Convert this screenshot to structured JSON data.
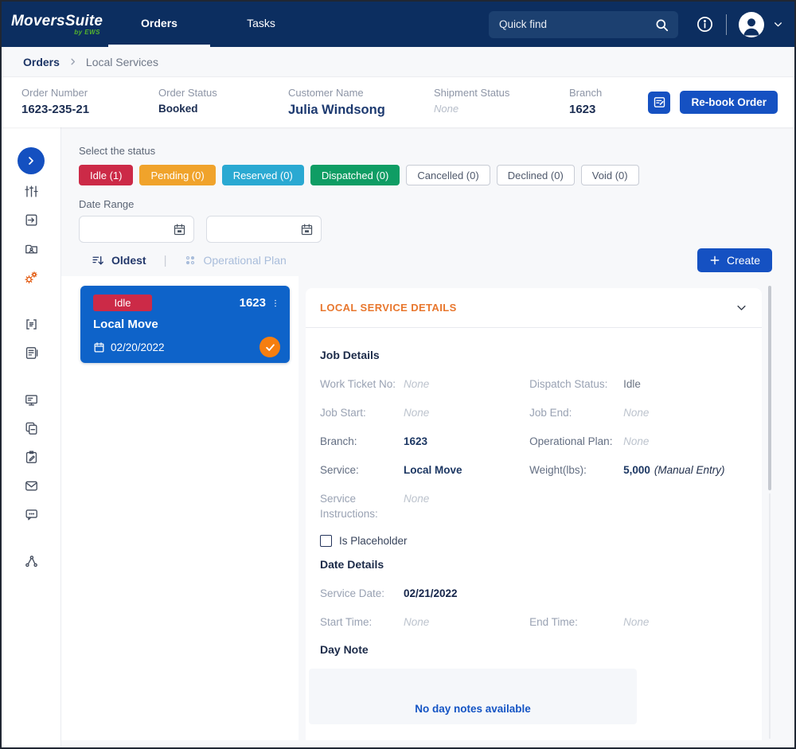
{
  "colors": {
    "navbar_bg": "#0C2E60",
    "accent_blue": "#1551C2",
    "card_blue": "#0E63C9",
    "details_header_orange": "#E8772E",
    "logo_byline_green": "#54B42D",
    "check_circle_orange": "#F57E10",
    "status_idle": "#CC2A47",
    "status_pending": "#F0A32B",
    "status_reserved": "#2AA9D2",
    "status_dispatched": "#0F9D64"
  },
  "navbar": {
    "logo_title": "MoversSuite",
    "logo_byline": "by EWS",
    "tab_orders": "Orders",
    "tab_tasks": "Tasks",
    "search_placeholder": "Quick find"
  },
  "breadcrumb": {
    "root": "Orders",
    "current": "Local Services"
  },
  "order_bar": {
    "order_number_label": "Order Number",
    "order_number": "1623-235-21",
    "order_status_label": "Order Status",
    "order_status": "Booked",
    "customer_name_label": "Customer Name",
    "customer_name": "Julia Windsong",
    "shipment_status_label": "Shipment Status",
    "shipment_status": "None",
    "branch_label": "Branch",
    "branch": "1623",
    "rebook_label": "Re-book Order"
  },
  "filters": {
    "select_label": "Select the status",
    "statuses": [
      {
        "label": "Idle (1)",
        "color": "#CC2A47"
      },
      {
        "label": "Pending (0)",
        "color": "#F0A32B"
      },
      {
        "label": "Reserved (0)",
        "color": "#2AA9D2"
      },
      {
        "label": "Dispatched (0)",
        "color": "#0F9D64"
      },
      {
        "label": "Cancelled (0)",
        "color": "#FFFFFF"
      },
      {
        "label": "Declined (0)",
        "color": "#FFFFFF"
      },
      {
        "label": "Void (0)",
        "color": "#FFFFFF"
      }
    ],
    "date_range_label": "Date Range",
    "start_date_value": "",
    "end_date_value": "",
    "sort_label": "Oldest",
    "plan_label": "Operational Plan",
    "create_label": "Create"
  },
  "card": {
    "status": "Idle",
    "number": "1623",
    "title": "Local Move",
    "date": "02/20/2022"
  },
  "details": {
    "header": "LOCAL SERVICE DETAILS",
    "job_section_title": "Job Details",
    "work_ticket_label": "Work Ticket No:",
    "work_ticket_value": "None",
    "dispatch_status_label": "Dispatch Status:",
    "dispatch_status_value": "Idle",
    "job_start_label": "Job Start:",
    "job_start_value": "None",
    "job_end_label": "Job End:",
    "job_end_value": "None",
    "branch_label": "Branch:",
    "branch_value": "1623",
    "op_plan_label": "Operational Plan:",
    "op_plan_value": "None",
    "service_label": "Service:",
    "service_value": "Local Move",
    "weight_label": "Weight(lbs):",
    "weight_value": "5,000",
    "weight_note": "(Manual Entry)",
    "service_instructions_label": "Service Instructions:",
    "service_instructions_value": "None",
    "placeholder_checkbox_label": "Is Placeholder",
    "date_section_title": "Date Details",
    "service_date_label": "Service Date:",
    "service_date_value": "02/21/2022",
    "start_time_label": "Start Time:",
    "start_time_value": "None",
    "end_time_label": "End Time:",
    "end_time_value": "None",
    "day_note_title": "Day Note",
    "day_note_empty": "No day notes available"
  },
  "sidebar": {
    "icons": [
      "expand",
      "work-queue",
      "order-entry",
      "customer-folder",
      "operations",
      "notes",
      "forms",
      "monitor",
      "documents",
      "clipboard-edit",
      "mail",
      "messages",
      "integrations"
    ]
  }
}
